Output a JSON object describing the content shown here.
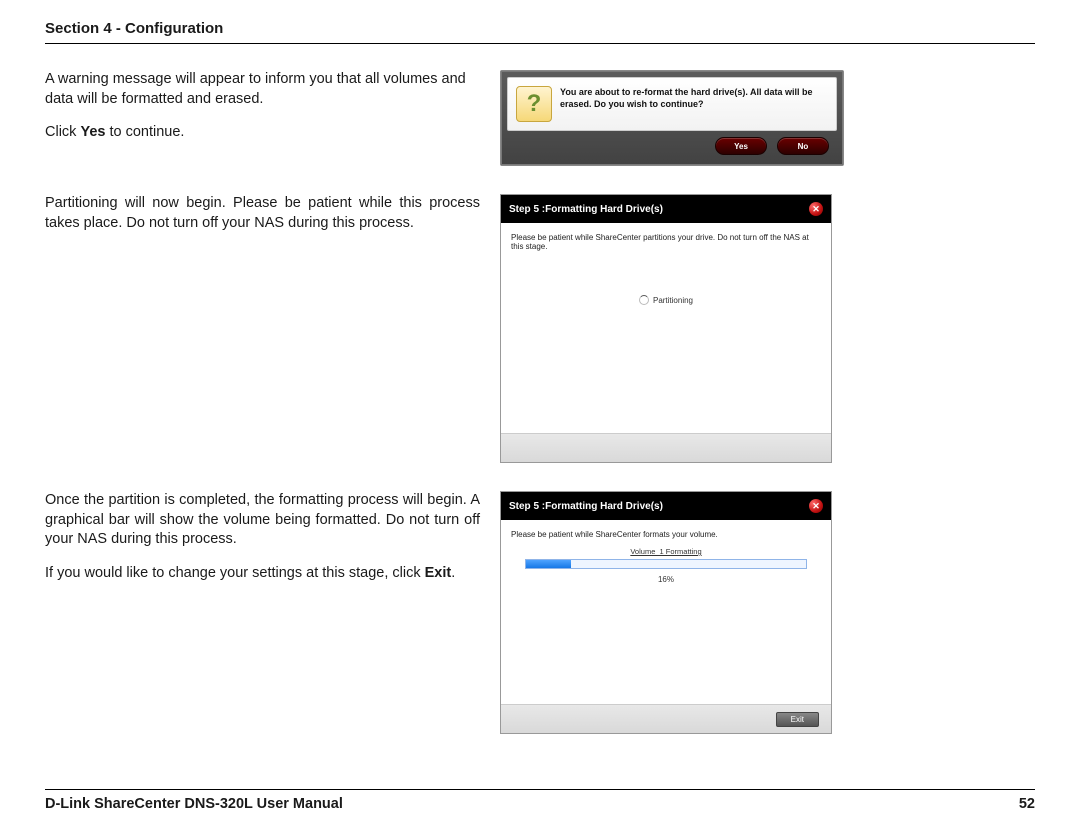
{
  "header": {
    "title": "Section 4 - Configuration"
  },
  "block1": {
    "para1": "A warning message will appear to inform you that all volumes and data will be formatted and erased.",
    "para2_pre": "Click ",
    "para2_bold": "Yes",
    "para2_post": " to continue.",
    "dialog": {
      "message": "You are about to re-format the hard drive(s). All data will be erased. Do you wish to continue?",
      "yes": "Yes",
      "no": "No"
    }
  },
  "block2": {
    "para": "Partitioning will now begin. Please be patient while this process takes place. Do not turn off your NAS during this process.",
    "wizard": {
      "title": "Step 5 :Formatting Hard Drive(s)",
      "note": "Please be patient while ShareCenter partitions your drive. Do not turn off the NAS at this stage.",
      "status": "Partitioning"
    }
  },
  "block3": {
    "para1": "Once the partition is completed, the formatting process will begin. A graphical bar will show the volume being formatted. Do not turn off your NAS during this process.",
    "para2_pre": "If you would like to change your settings at this stage, click ",
    "para2_bold": "Exit",
    "para2_post": ".",
    "wizard": {
      "title": "Step 5 :Formatting Hard Drive(s)",
      "note": "Please be patient while ShareCenter formats your volume.",
      "volume_label": "Volume_1 Formatting",
      "percent_value": 16,
      "percent_text": "16%",
      "exit": "Exit"
    }
  },
  "footer": {
    "left": "D-Link ShareCenter DNS-320L User Manual",
    "right": "52"
  }
}
